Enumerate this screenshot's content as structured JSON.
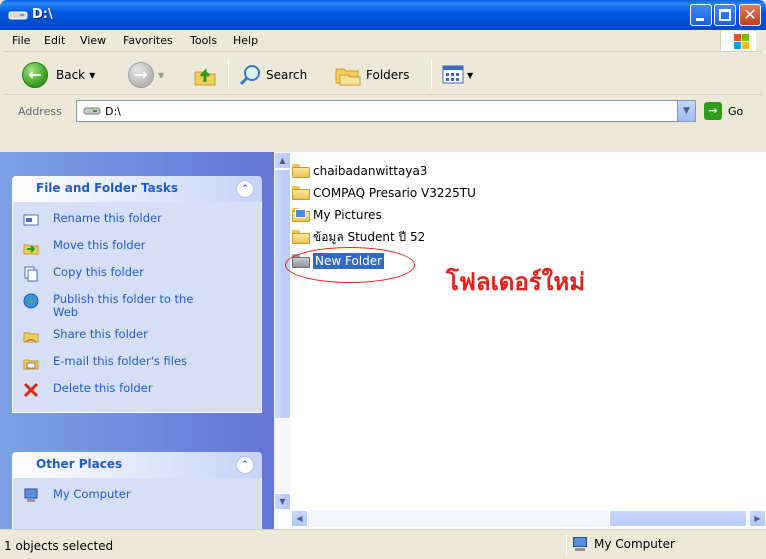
{
  "window": {
    "title": "D:\\",
    "buttons": [
      "minimize",
      "maximize",
      "close"
    ]
  },
  "menu": {
    "items": [
      "File",
      "Edit",
      "View",
      "Favorites",
      "Tools",
      "Help"
    ]
  },
  "toolbar": {
    "back_label": "Back",
    "search_label": "Search",
    "folders_label": "Folders"
  },
  "address": {
    "label": "Address",
    "value": "D:\\",
    "go_label": "Go"
  },
  "taskpane": {
    "file_tasks": {
      "title": "File and Folder Tasks",
      "items": [
        {
          "label": "Rename this folder",
          "icon": "rename-icon"
        },
        {
          "label": "Move this folder",
          "icon": "move-icon"
        },
        {
          "label": "Copy this folder",
          "icon": "copy-icon"
        },
        {
          "label": "Publish this folder to the Web",
          "icon": "globe-icon"
        },
        {
          "label": "Share this folder",
          "icon": "share-icon"
        },
        {
          "label": "E-mail this folder's files",
          "icon": "email-icon"
        },
        {
          "label": "Delete this folder",
          "icon": "delete-icon"
        }
      ]
    },
    "other_places": {
      "title": "Other Places",
      "items": [
        {
          "label": "My Computer",
          "icon": "computer-icon"
        }
      ]
    }
  },
  "files": [
    {
      "name": "chaibadanwittaya3",
      "type": "folder"
    },
    {
      "name": "COMPAQ Presario V3225TU",
      "type": "folder"
    },
    {
      "name": "My Pictures",
      "type": "pictures-folder"
    },
    {
      "name": "ข้อมูล Student ปี 52",
      "type": "folder"
    },
    {
      "name": "New Folder",
      "type": "folder-selected"
    }
  ],
  "annotation": {
    "text": "โฟลเดอร์ใหม่",
    "color": "#e2231a"
  },
  "status": {
    "left": "1 objects selected",
    "right": "My Computer"
  },
  "colors": {
    "titlebar": "#0058e6",
    "taskpane_link": "#215dc6",
    "selection": "#316ac5"
  }
}
